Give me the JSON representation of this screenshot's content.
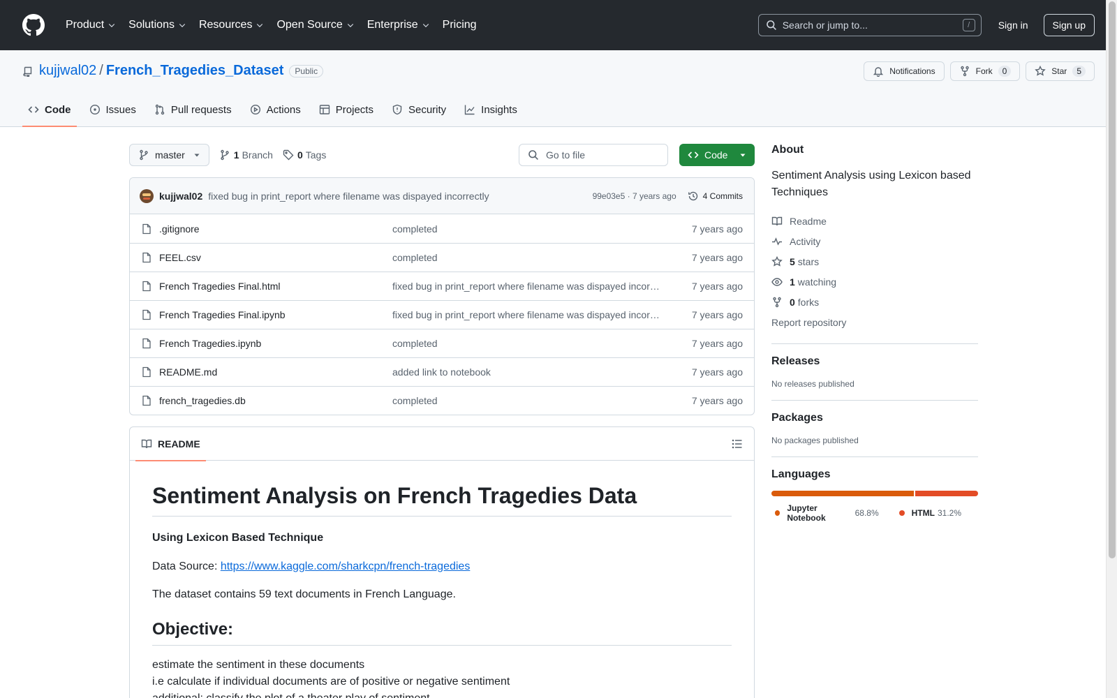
{
  "header": {
    "nav": [
      {
        "label": "Product",
        "dropdown": true
      },
      {
        "label": "Solutions",
        "dropdown": true
      },
      {
        "label": "Resources",
        "dropdown": true
      },
      {
        "label": "Open Source",
        "dropdown": true
      },
      {
        "label": "Enterprise",
        "dropdown": true
      },
      {
        "label": "Pricing",
        "dropdown": false
      }
    ],
    "search_placeholder": "Search or jump to...",
    "search_shortcut": "/",
    "signin": "Sign in",
    "signup": "Sign up"
  },
  "repo": {
    "owner": "kujjwal02",
    "separator": "/",
    "name": "French_Tragedies_Dataset",
    "visibility": "Public",
    "actions": {
      "notifications": "Notifications",
      "fork": "Fork",
      "fork_count": "0",
      "star": "Star",
      "star_count": "5"
    },
    "tabs": [
      {
        "label": "Code",
        "icon": "code-icon",
        "active": true
      },
      {
        "label": "Issues",
        "icon": "issue-icon",
        "active": false
      },
      {
        "label": "Pull requests",
        "icon": "pull-request-icon",
        "active": false
      },
      {
        "label": "Actions",
        "icon": "play-icon",
        "active": false
      },
      {
        "label": "Projects",
        "icon": "table-icon",
        "active": false
      },
      {
        "label": "Security",
        "icon": "shield-icon",
        "active": false
      },
      {
        "label": "Insights",
        "icon": "graph-icon",
        "active": false
      }
    ]
  },
  "toolbar": {
    "branch": "master",
    "branch_count": "1",
    "branch_label": "Branch",
    "tag_count": "0",
    "tag_label": "Tags",
    "goto_placeholder": "Go to file",
    "code_label": "Code"
  },
  "commit": {
    "author": "kujjwal02",
    "message": "fixed bug in print_report where filename was dispayed incorrectly",
    "meta": "99e03e5 · 7 years ago",
    "commits_label": "4 Commits"
  },
  "files": [
    {
      "name": ".gitignore",
      "message": "completed",
      "time": "7 years ago"
    },
    {
      "name": "FEEL.csv",
      "message": "completed",
      "time": "7 years ago"
    },
    {
      "name": "French Tragedies Final.html",
      "message": "fixed bug in print_report where filename was dispayed incorrectly",
      "time": "7 years ago"
    },
    {
      "name": "French Tragedies Final.ipynb",
      "message": "fixed bug in print_report where filename was dispayed incorrectly",
      "time": "7 years ago"
    },
    {
      "name": "French Tragedies.ipynb",
      "message": "completed",
      "time": "7 years ago"
    },
    {
      "name": "README.md",
      "message": "added link to notebook",
      "time": "7 years ago"
    },
    {
      "name": "french_tragedies.db",
      "message": "completed",
      "time": "7 years ago"
    }
  ],
  "readme": {
    "tab_label": "README",
    "h1": "Sentiment Analysis on French Tragedies Data",
    "h3": "Using Lexicon Based Technique",
    "source_label": "Data Source: ",
    "source_link": "https://www.kaggle.com/sharkcpn/french-tragedies",
    "dataset_text": "The dataset contains 59 text documents in French Language.",
    "h2": "Objective:",
    "lines": [
      "estimate the sentiment in these documents",
      "i.e calculate if individual documents are of positive or negative sentiment",
      "additional: classify the plot of a theater play of sentiment"
    ]
  },
  "sidebar": {
    "about_title": "About",
    "description": "Sentiment Analysis using Lexicon based Techniques",
    "items": [
      {
        "icon": "book-icon",
        "count": "",
        "label": "Readme"
      },
      {
        "icon": "pulse-icon",
        "count": "",
        "label": "Activity"
      },
      {
        "icon": "star-icon",
        "count": "5",
        "label": "stars"
      },
      {
        "icon": "eye-icon",
        "count": "1",
        "label": "watching"
      },
      {
        "icon": "fork-icon",
        "count": "0",
        "label": "forks"
      }
    ],
    "report": "Report repository",
    "releases_title": "Releases",
    "releases_text": "No releases published",
    "packages_title": "Packages",
    "packages_text": "No packages published",
    "languages_title": "Languages",
    "languages": [
      {
        "name": "Jupyter Notebook",
        "percent": "68.8%",
        "value": 68.8,
        "color": "#DA5B0B"
      },
      {
        "name": "HTML",
        "percent": "31.2%",
        "value": 31.2,
        "color": "#e34c26"
      }
    ]
  }
}
